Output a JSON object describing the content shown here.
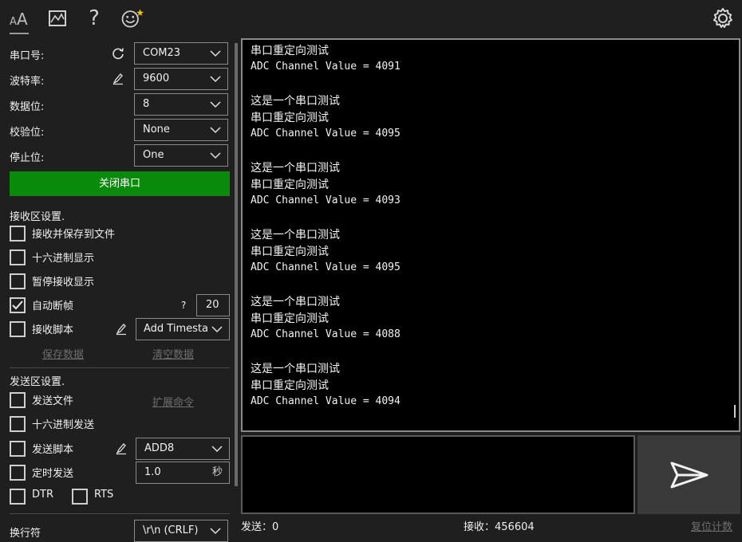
{
  "toolbar": {
    "icons": [
      "font-icon",
      "chart-icon",
      "help-icon",
      "smiley-icon",
      "settings-icon"
    ],
    "help_glyph": "?"
  },
  "serial": {
    "port_label": "串口号:",
    "port_value": "COM23",
    "baud_label": "波特率:",
    "baud_value": "9600",
    "databits_label": "数据位:",
    "databits_value": "8",
    "parity_label": "校验位:",
    "parity_value": "None",
    "stopbits_label": "停止位:",
    "stopbits_value": "One",
    "close_button": "关闭串口"
  },
  "receive": {
    "section_title": "接收区设置.",
    "save_to_file": "接收并保存到文件",
    "hex_display": "十六进制显示",
    "pause_display": "暂停接收显示",
    "auto_frame": "自动断帧",
    "auto_frame_help": "?",
    "auto_frame_value": "20",
    "script": "接收脚本",
    "script_value": "Add Timesta",
    "save_data": "保存数据",
    "clear_data": "清空数据"
  },
  "send": {
    "section_title": "发送区设置.",
    "send_file": "发送文件",
    "extend_cmd": "扩展命令",
    "hex_send": "十六进制发送",
    "script": "发送脚本",
    "script_value": "ADD8",
    "timed_send": "定时发送",
    "timed_value": "1.0",
    "timed_unit": "秒",
    "dtr": "DTR",
    "rts": "RTS",
    "newline_label": "换行符",
    "newline_value": "\\r\\n (CRLF)"
  },
  "terminal": {
    "lines": [
      {
        "text": "串口重定向测试",
        "kind": "cn"
      },
      {
        "text": "ADC Channel Value = 4091",
        "kind": "mono"
      },
      {
        "text": "",
        "kind": "blank"
      },
      {
        "text": "这是一个串口测试",
        "kind": "cn"
      },
      {
        "text": "串口重定向测试",
        "kind": "cn"
      },
      {
        "text": "ADC Channel Value = 4095",
        "kind": "mono"
      },
      {
        "text": "",
        "kind": "blank"
      },
      {
        "text": "这是一个串口测试",
        "kind": "cn"
      },
      {
        "text": "串口重定向测试",
        "kind": "cn"
      },
      {
        "text": "ADC Channel Value = 4093",
        "kind": "mono"
      },
      {
        "text": "",
        "kind": "blank"
      },
      {
        "text": "这是一个串口测试",
        "kind": "cn"
      },
      {
        "text": "串口重定向测试",
        "kind": "cn"
      },
      {
        "text": "ADC Channel Value = 4095",
        "kind": "mono"
      },
      {
        "text": "",
        "kind": "blank"
      },
      {
        "text": "这是一个串口测试",
        "kind": "cn"
      },
      {
        "text": "串口重定向测试",
        "kind": "cn"
      },
      {
        "text": "ADC Channel Value = 4088",
        "kind": "mono"
      },
      {
        "text": "",
        "kind": "blank"
      },
      {
        "text": "这是一个串口测试",
        "kind": "cn"
      },
      {
        "text": "串口重定向测试",
        "kind": "cn"
      },
      {
        "text": "ADC Channel Value = 4094",
        "kind": "mono"
      }
    ]
  },
  "status": {
    "sent": "发送：0",
    "received": "接收：456604",
    "reset": "复位计数"
  },
  "colors": {
    "accent_green": "#0a8a0a",
    "background": "#1f1f1f",
    "terminal_bg": "#000000"
  }
}
